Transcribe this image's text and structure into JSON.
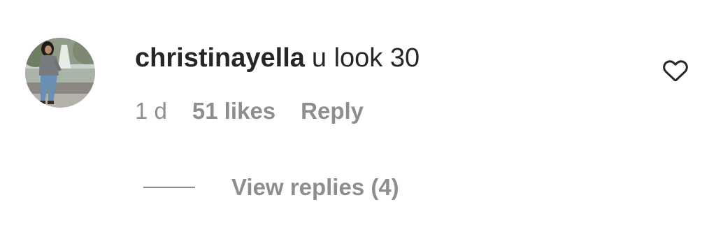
{
  "comment": {
    "username": "christinayella",
    "text": "u look 30",
    "time": "1 d",
    "likes": "51 likes",
    "reply_label": "Reply",
    "view_replies_label": "View replies (4)",
    "like_icon": "heart-outline-icon",
    "avatar": "profile-photo"
  },
  "colors": {
    "primary_text": "#262626",
    "secondary_text": "#8e8e8e",
    "background": "#ffffff"
  }
}
